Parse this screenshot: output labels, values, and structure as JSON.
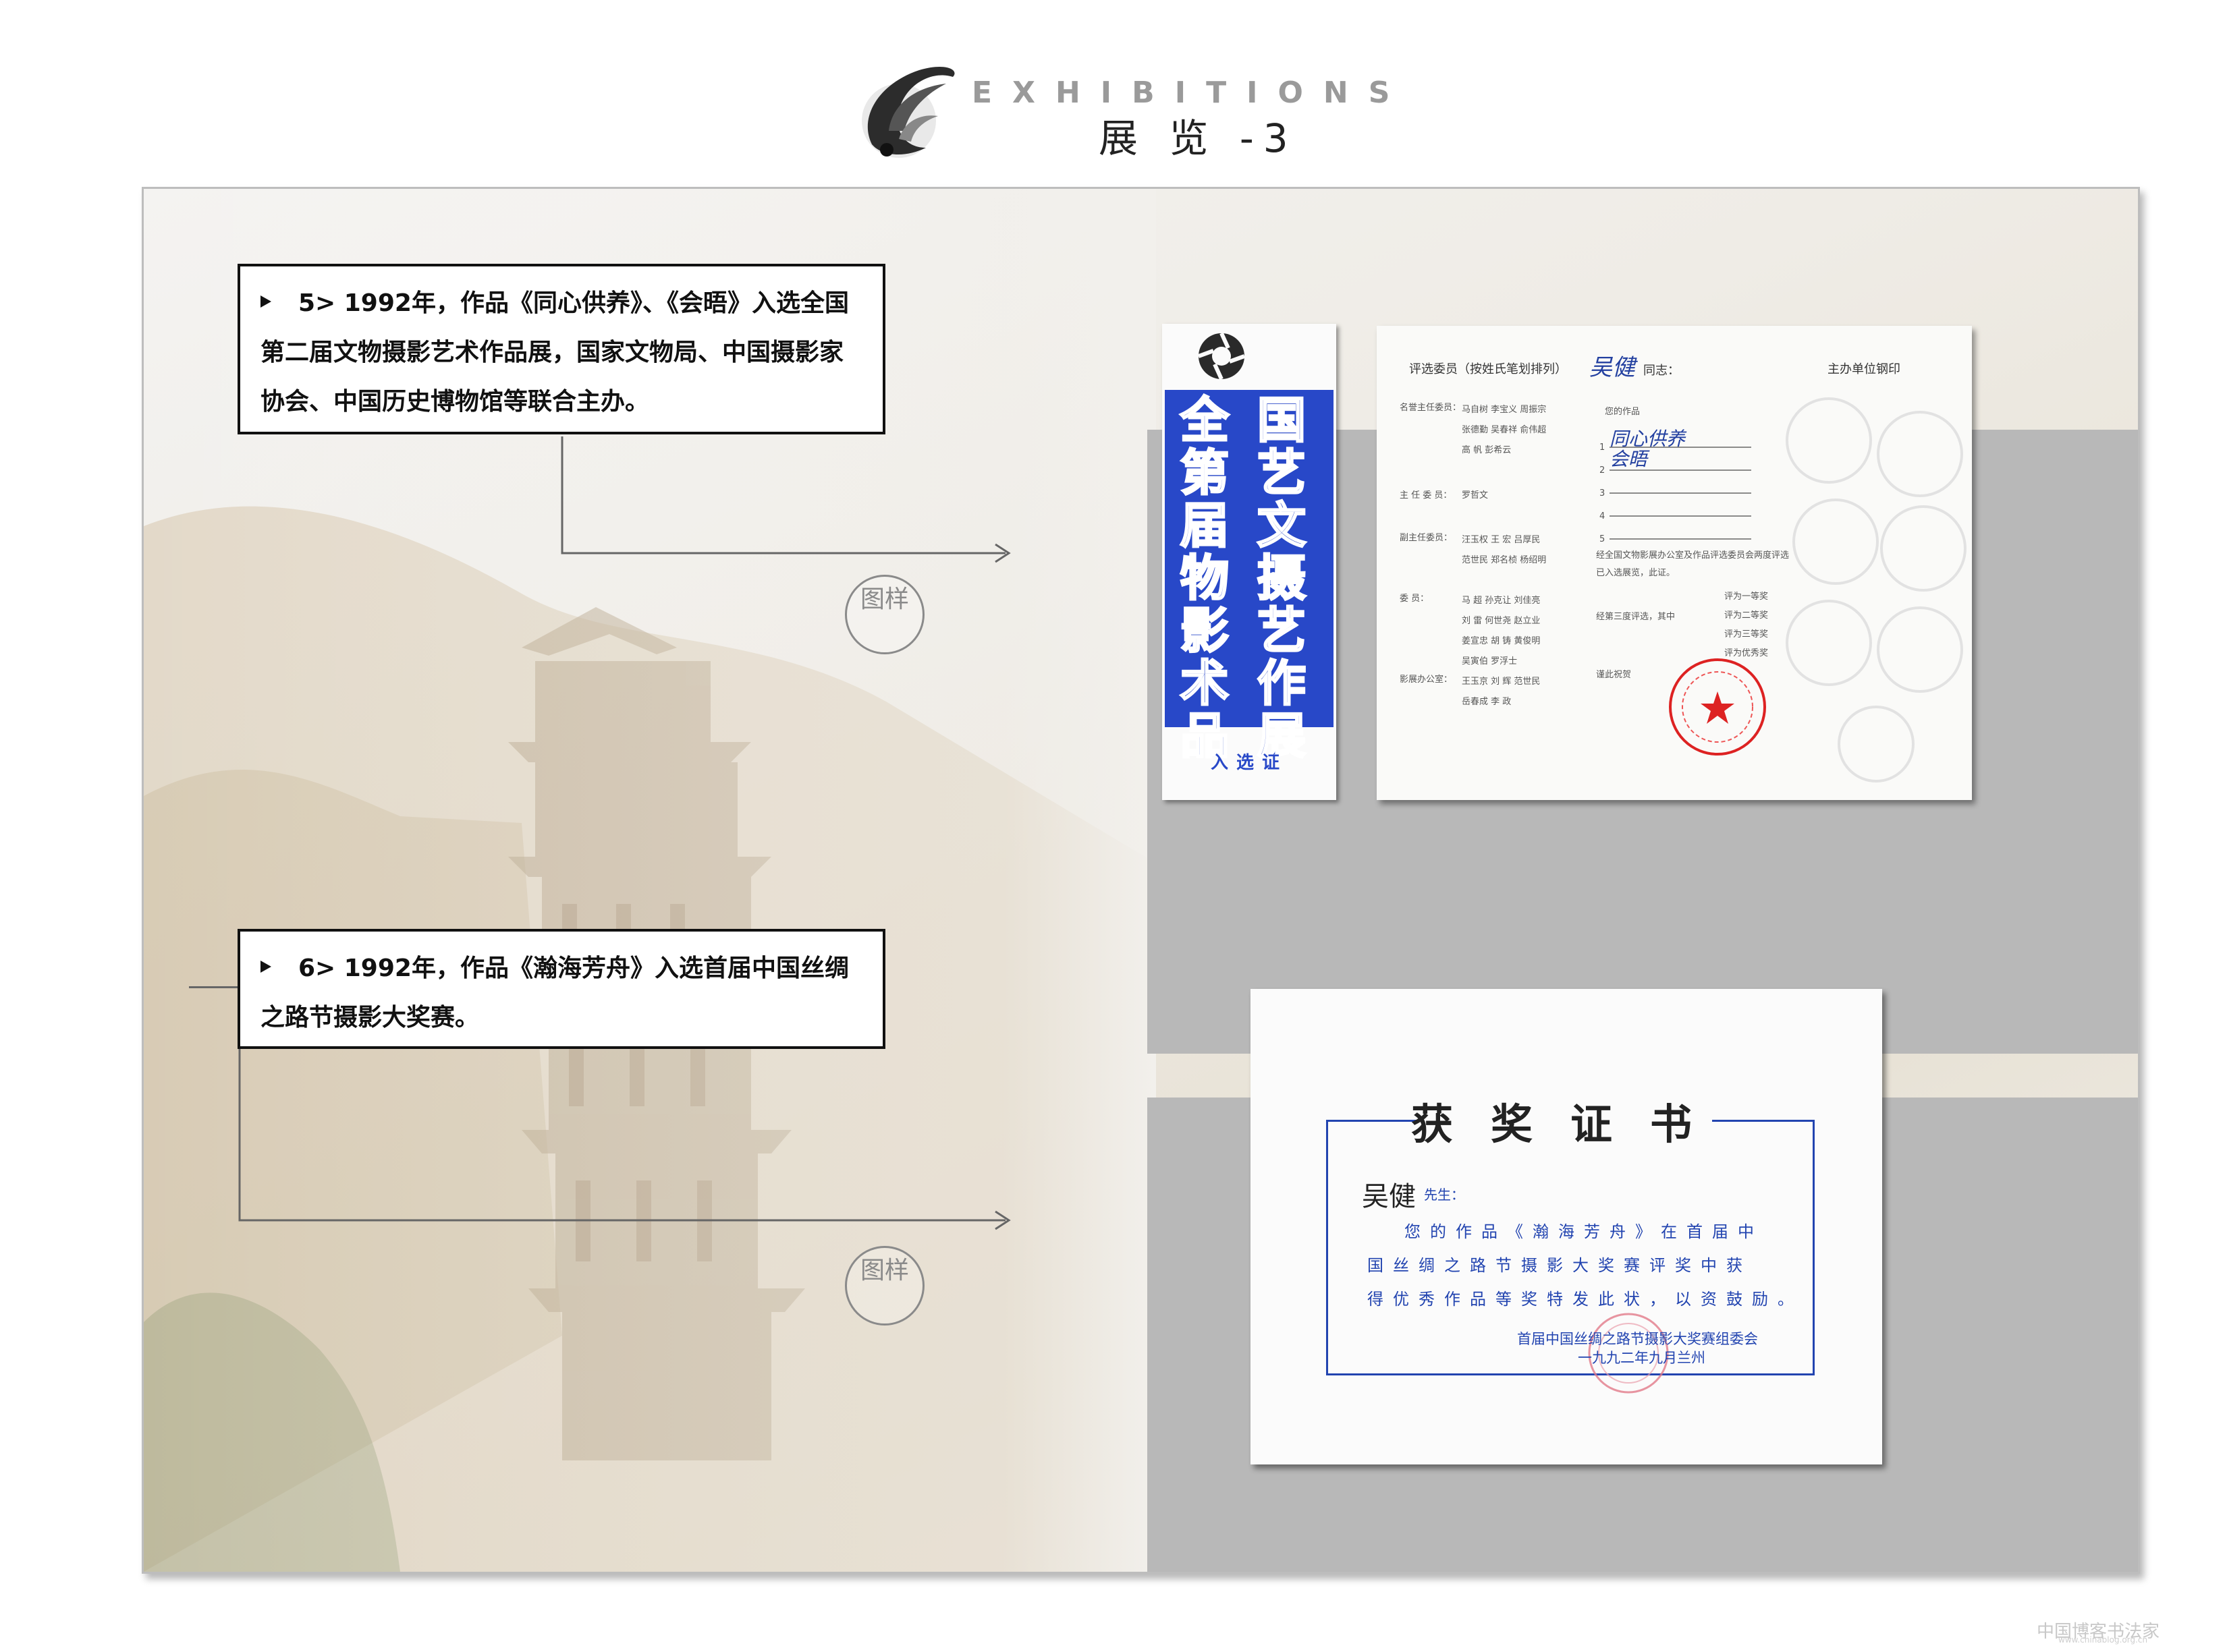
{
  "header": {
    "eng_title": "EXHIBITIONS",
    "cn_title": "展 览 -3"
  },
  "items": [
    {
      "caption": "5> 1992年，作品《同心供养》、《会晤》入选全国第二届文物摄影艺术作品展，国家文物局、中国摄影家协会、中国历史博物馆等联合主办。",
      "badge": "图样"
    },
    {
      "caption": "6> 1992年，作品《瀚海芳舟》入选首届中国丝绸之路节摄影大奖赛。",
      "badge": "图样"
    }
  ],
  "booklet": {
    "col1": "国艺文摄艺作展",
    "col2": "全第届物影术品",
    "footer": "入选证"
  },
  "cert1": {
    "header_left": "评选委员（按姓氏笔划排列）",
    "addressee": "吴健",
    "addressee_suffix": "同志：",
    "header_right": "主办单位钢印",
    "works_label": "您的作品",
    "work1": "同心供养",
    "work2": "会晤",
    "rows": [
      {
        "label": "名誉主任委员：",
        "names": "马自树 李宝义 周振宗\n张德勤 吴春祥 俞伟超\n高 帆 彭希云"
      },
      {
        "label": "主 任 委 员：",
        "names": "罗哲文"
      },
      {
        "label": "副主任委员：",
        "names": "汪玉权 王 宏 吕厚民\n范世民 郑名桢 杨绍明"
      },
      {
        "label": "委 员：",
        "names": "马 超 孙克让 刘佳亮\n刘 雷 何世尧 赵立业\n姜宣忠 胡 铸 黄俊明\n吴寅伯 罗浮士"
      },
      {
        "label": "影展办公室：",
        "names": "王玉京 刘 辉 范世民\n岳春成 李 政"
      }
    ],
    "notice": "经全国文物影展办公室及作品评选委员会两度评选已入选展览，此证。",
    "second_round": "经第三度评选，其中",
    "prizes": [
      "评为一等奖",
      "评为二等奖",
      "评为三等奖",
      "评为优秀奖"
    ],
    "closing": "谨此祝贺"
  },
  "cert2": {
    "title": "获奖证书",
    "addressee": "吴健",
    "addressee_suffix": "先生：",
    "line1": "您的作品《瀚海芳舟》在首届中",
    "line2": "国丝绸之路节摄影大奖赛评奖中获",
    "line3": "得优秀作品等奖特发此状，以资鼓励。",
    "org": "首届中国丝绸之路节摄影大奖赛组委会",
    "date": "一九九二年九月兰州"
  },
  "watermark": {
    "text": "中国博客书法家",
    "url": "www.chinablog.org.cn"
  }
}
